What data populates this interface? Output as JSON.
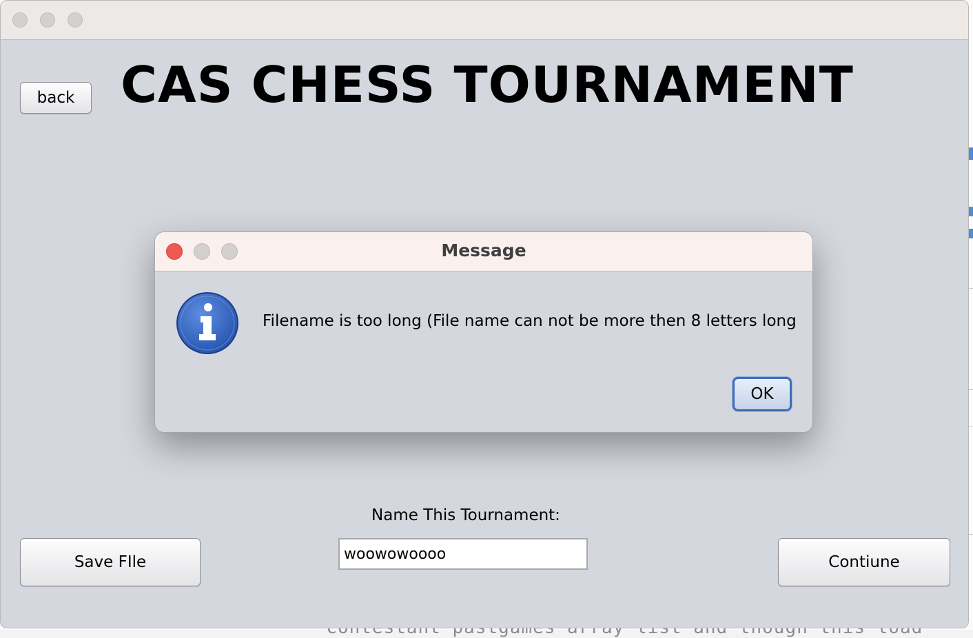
{
  "window": {
    "title": ""
  },
  "app": {
    "title": "CAS CHESS TOURNAMENT",
    "back_label": "back",
    "save_label": "Save FIle",
    "continue_label": "Contiune",
    "name_label": "Name This Tournament:",
    "name_value": "woowowoooo"
  },
  "dialog": {
    "title": "Message",
    "message": "Filename is too long (File name can not be more then 8 letters long",
    "ok_label": "OK",
    "icon": "info-icon"
  },
  "background": {
    "code_line": "* contestant pastgames array list and though this load"
  },
  "colors": {
    "window_bg": "#d5d7de",
    "close_red": "#ee5a52",
    "info_blue": "#2f5fb8",
    "ok_border": "#3d6fb5"
  }
}
